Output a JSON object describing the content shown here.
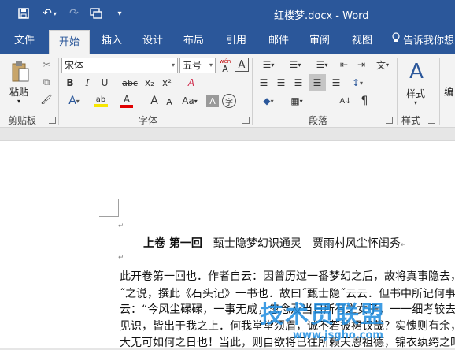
{
  "window": {
    "title": "红楼梦.docx - Word"
  },
  "quick_access": {
    "save": "save-icon",
    "undo": "undo-icon",
    "redo": "redo-icon",
    "touch_mode": "touch-mode-icon",
    "customize": "customize-icon",
    "undo_glyph": "↶",
    "undo_arrow": "▾",
    "redo_glyph": "↷",
    "customize_glyph": "▾"
  },
  "tabs": [
    "文件",
    "开始",
    "插入",
    "设计",
    "布局",
    "引用",
    "邮件",
    "审阅",
    "视图",
    "告诉我你想"
  ],
  "ribbon": {
    "clipboard": {
      "label": "剪贴板",
      "paste": "粘贴",
      "paste_arrow": "▾",
      "cut_glyph": "✂",
      "copy_glyph": "⧉",
      "painter_glyph": "🖌"
    },
    "font": {
      "label": "字体",
      "font_name": "宋体",
      "font_size": "五号",
      "phonetic": "wén",
      "phonetic_char": "A",
      "border_char": "A",
      "combo_arrow": "▾",
      "grow": "A",
      "grow_sup": "^",
      "shrink": "A",
      "shrink_sup": "˅",
      "case": "Aa",
      "case_arrow": "▾",
      "bold": "B",
      "italic": "I",
      "underline": "U",
      "strike": "abc",
      "subscript": "x₂",
      "superscript": "x²",
      "clear_glyph": "A",
      "effects": "A",
      "effects_arrow": "▾",
      "highlight": "ab",
      "highlight_arrow": "▾",
      "font_color": "A",
      "font_color_arrow": "▾",
      "char_shading": "A",
      "enclose": "字",
      "font_grow": "A",
      "font_shrink": "A",
      "highlight_color": "#f7e600",
      "font_color_bar": "#e00000"
    },
    "paragraph": {
      "label": "段落",
      "bullets_glyph": "☰",
      "numbering_glyph": "☰",
      "multilevel_glyph": "☰",
      "align_left": "☰",
      "align_center": "☰",
      "align_right": "☰",
      "justify": "☰",
      "distributed": "☰",
      "line_spacing": "↕",
      "shading": "◆",
      "borders": "▦",
      "sort": "A↓",
      "marks": "¶",
      "indent_dec": "⇤",
      "indent_inc": "⇥",
      "chinese_layout": "文",
      "chinese_arrow": "▾",
      "dropdown": "▾"
    },
    "styles": {
      "label": "样式",
      "button": "样式",
      "styles_glyph": "A",
      "styles_arrow": "▾"
    },
    "editing": {
      "button": "编"
    }
  },
  "document": {
    "para_mark": "↵",
    "heading_bold": "上卷 第一回",
    "heading_rest": "甄士隐梦幻识通灵　贾雨村风尘怀闺秀",
    "lines": [
      "此开卷第一回也．作者自云：因曾历过一番梦幻之后，故将真事隐去，",
      "˝之说，撰此《石头记》一书也．故曰˝甄士隐˝云云．但书中所记何事何",
      "云：“今风尘碌碌，一事无成，忽念及当日所有之女子，一一细考较去",
      "见识，皆出于我之上．何我堂堂须眉，诚不若彼裙钗哉？实愧则有余，悔",
      "大无可如何之日也！当此，则自欲将已往所赖天恩祖德，锦衣纨绔之时"
    ]
  },
  "watermark": {
    "logo": "技术员联盟",
    "url": "www.jsgho.com"
  }
}
